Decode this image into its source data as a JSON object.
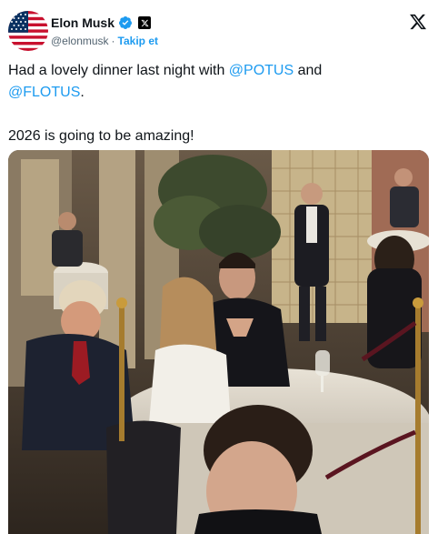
{
  "author": {
    "display_name": "Elon Musk",
    "handle": "@elonmusk",
    "separator": "·",
    "follow_label": "Takip et",
    "avatar_icon": "us-flag-avatar",
    "verified_icon": "verified-badge-icon",
    "affiliation_icon": "x-affiliation-icon"
  },
  "platform": {
    "logo_icon": "x-logo-icon"
  },
  "tweet": {
    "text_before_mention1": "Had a lovely dinner last night with ",
    "mention1": "@POTUS",
    "text_between": " and",
    "mention2": "@FLOTUS",
    "text_end": ".",
    "second_paragraph": "2026 is going to be amazing!"
  },
  "media": {
    "kind": "photo"
  },
  "colors": {
    "text": "#0f1419",
    "secondary": "#536471",
    "accent": "#1d9bf0",
    "verified": "#1d9bf0"
  }
}
